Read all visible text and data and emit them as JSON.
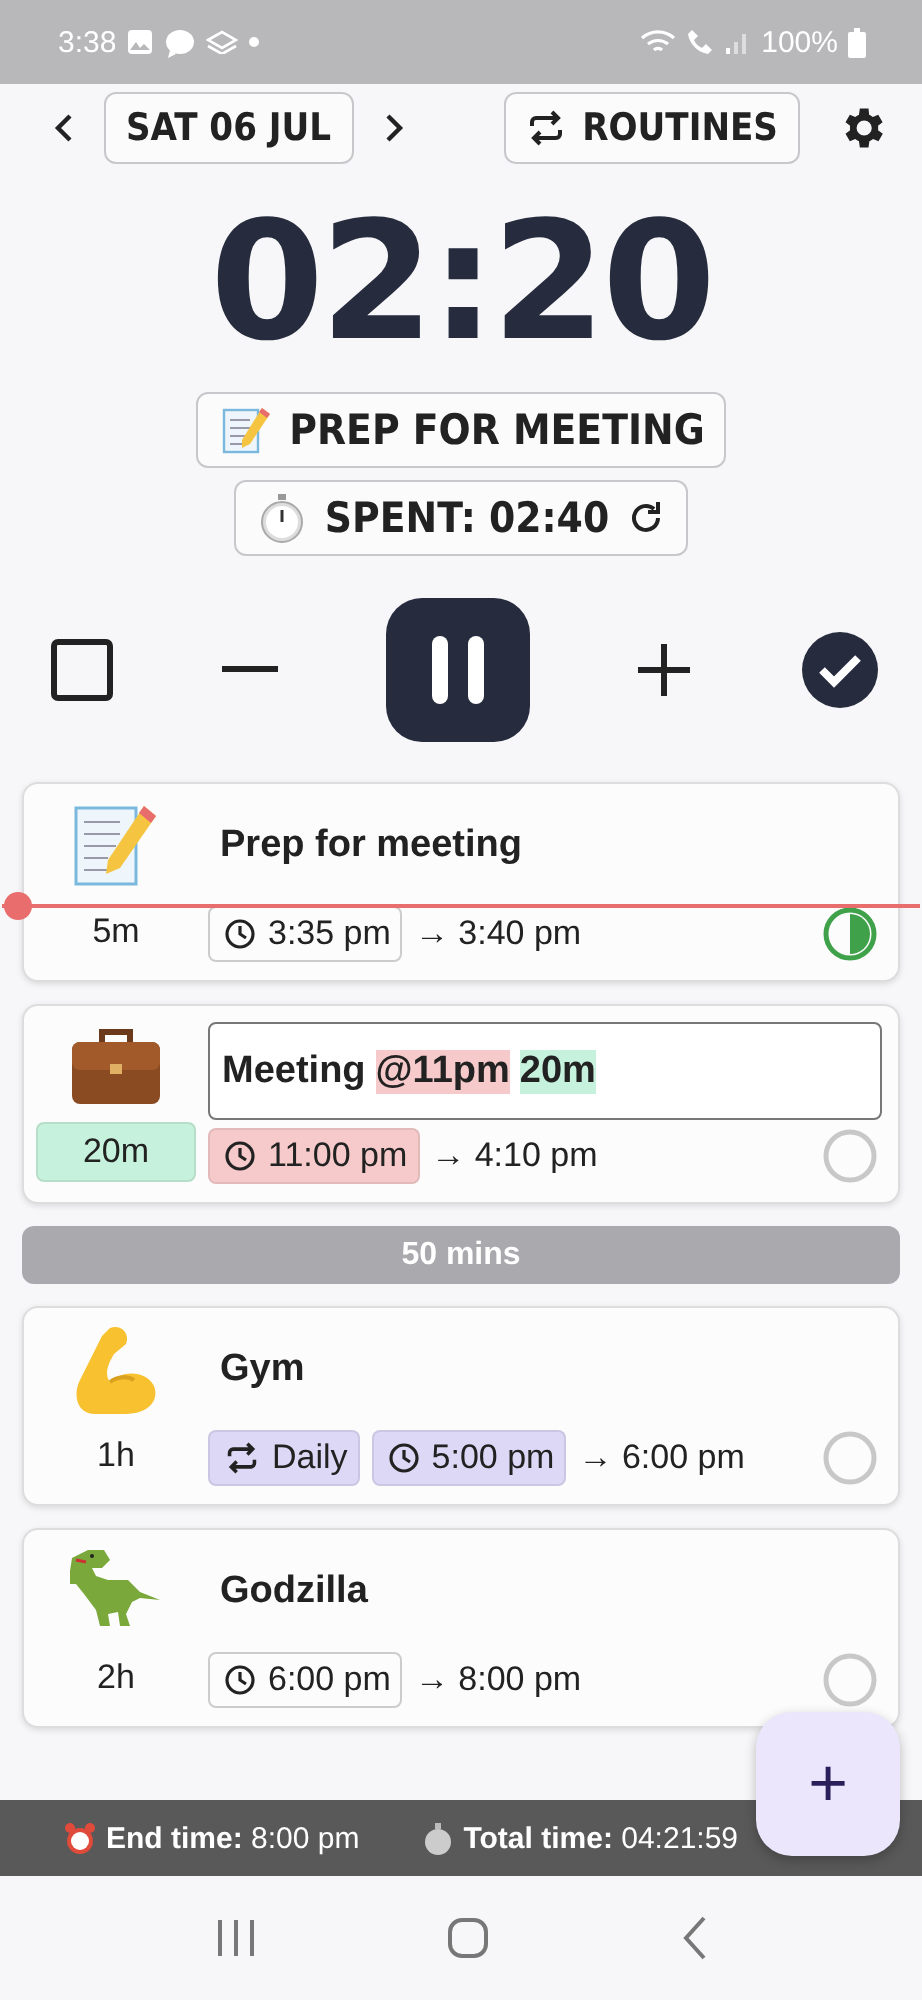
{
  "status_bar": {
    "time": "3:38",
    "battery": "100%"
  },
  "header": {
    "date": "SAT 06 JUL",
    "routines": "ROUTINES"
  },
  "timer": {
    "display": "02:20",
    "current_task": "PREP FOR MEETING",
    "spent": "SPENT: 02:40"
  },
  "tasks": [
    {
      "kind": "task",
      "title": [
        {
          "text": "Prep for meeting"
        }
      ],
      "editing": false,
      "duration": {
        "text": "5m"
      },
      "tags": [
        {
          "kind": "time",
          "text": "3:35 pm"
        }
      ],
      "end": "→ 3:40 pm",
      "level": 0.5,
      "now_marker": true
    },
    {
      "kind": "task",
      "title": [
        {
          "text": "Meeting"
        },
        {
          "text": "@11pm",
          "color": "#f6caca"
        },
        {
          "text": "20m",
          "color": "#c6f1dc"
        }
      ],
      "editing": true,
      "duration": {
        "text": "20m",
        "color": "#c6f1dc"
      },
      "tags": [
        {
          "kind": "time",
          "text": "11:00 pm",
          "color": "#f6caca"
        }
      ],
      "end": "→ 4:10 pm",
      "now_marker": false
    },
    {
      "kind": "gap",
      "text": "50 mins"
    },
    {
      "kind": "task",
      "title": [
        {
          "text": "Gym"
        }
      ],
      "editing": false,
      "duration": {
        "text": "1h"
      },
      "tags": [
        {
          "kind": "repeat",
          "text": "Daily",
          "color": "#ddd8f6"
        },
        {
          "kind": "time",
          "text": "5:00 pm",
          "color": "#ddd8f6"
        }
      ],
      "end": "→ 6:00 pm",
      "now_marker": false
    },
    {
      "kind": "task",
      "title": [
        {
          "text": "Godzilla"
        }
      ],
      "editing": false,
      "duration": {
        "text": "2h"
      },
      "tags": [
        {
          "kind": "time",
          "text": "6:00 pm"
        }
      ],
      "end": "→ 8:00 pm",
      "now_marker": false
    }
  ],
  "summary": {
    "end_label": "End time:",
    "end_value": "8:00 pm",
    "total_label": "Total time:",
    "total_value": "04:21:59"
  },
  "fab": "+"
}
